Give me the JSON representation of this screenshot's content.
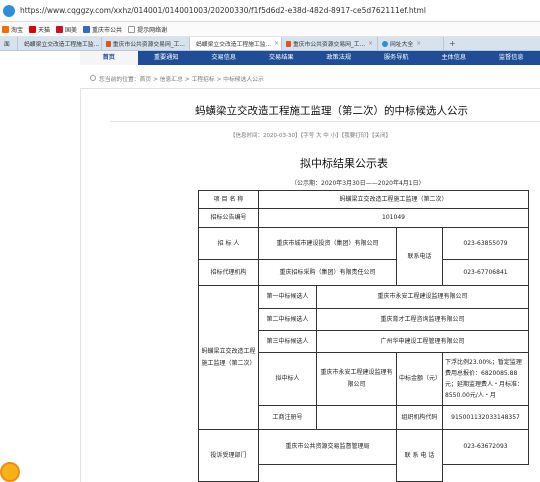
{
  "browser": {
    "url": "https://www.cqggzy.com/xxhz/014001/014001003/20200330/f1f5d6d2-e38d-482d-8917-ce5d762111ef.html",
    "favorites": [
      "淘宝",
      "天猫",
      "国美",
      "重庆市公共",
      "提示网络谢"
    ],
    "tabs": [
      {
        "label": "蚂蟥梁立交改造工程施工监...",
        "active": false
      },
      {
        "label": "重庆市公共资源交易网_工...",
        "active": false
      },
      {
        "label": "蚂蟥梁立交改造工程施工监...",
        "active": true
      },
      {
        "label": "重庆市公共资源交易网_工...",
        "active": false
      },
      {
        "label": "网址大全",
        "active": false
      }
    ],
    "new_tab": "+"
  },
  "nav": [
    "首页",
    "重要通知",
    "交易信息",
    "交易结果",
    "政策法规",
    "服务导航",
    "主体信息",
    "监督信息"
  ],
  "breadcrumb": "您当前的位置：首页 > 信息汇总 > 工程招标 > 中标候选人公示",
  "page_title": "蚂蟥梁立交改造工程施工监理（第二次）的中标候选人公示",
  "meta": "【信息时间：2020-03-30】【字号 大 中 小】【我要打印】【关闭】",
  "notice": {
    "title": "拟中标结果公示表",
    "period": "（公示期：2020年3月30日——2020年4月1日）",
    "project_name_label": "项 目 名 称",
    "project_name": "蚂蟥梁立交改造工程施工监理（第二次）",
    "announcement_no_label": "招标公告编号",
    "announcement_no": "101049",
    "tenderer_label": "招  标  人",
    "tenderer": "重庆市城市建设投资（集团）有限公司",
    "contact_phone_label": "联系电话",
    "tenderer_phone": "023-63855079",
    "agency_label": "招标代理机构",
    "agency": "重庆招标采购（集团）有限责任公司",
    "agency_phone": "023-67706841",
    "group_label": "蚂蟥梁立交改造工程施工监理（第二次）",
    "candidate1_label": "第一中标候选人",
    "candidate1": "重庆市永安工程建设监理有限公司",
    "candidate2_label": "第二中标候选人",
    "candidate2": "重庆育才工程咨询监理有限公司",
    "candidate3_label": "第三中标候选人",
    "candidate3": "广州华申建设工程管理有限公司",
    "winner_label": "拟中标人",
    "winner": "重庆市永安工程建设监理有限公司",
    "price_label": "中标金额（元）",
    "price": "下浮比例23.00%；暂定监理费用总报价：6820085.88元；延期监理费人・月标准：8550.00元/人・月",
    "reg_label": "工商注册号",
    "reg_value": "",
    "org_code_label": "组织机构代码",
    "org_code": "915001132033148357",
    "complaint_label": "投诉受理部门",
    "complaint_dept": "重庆市公共资源交易监督管理局",
    "complaint_phone_label": "联 系 电 话",
    "complaint_phone": "023-63672093"
  }
}
